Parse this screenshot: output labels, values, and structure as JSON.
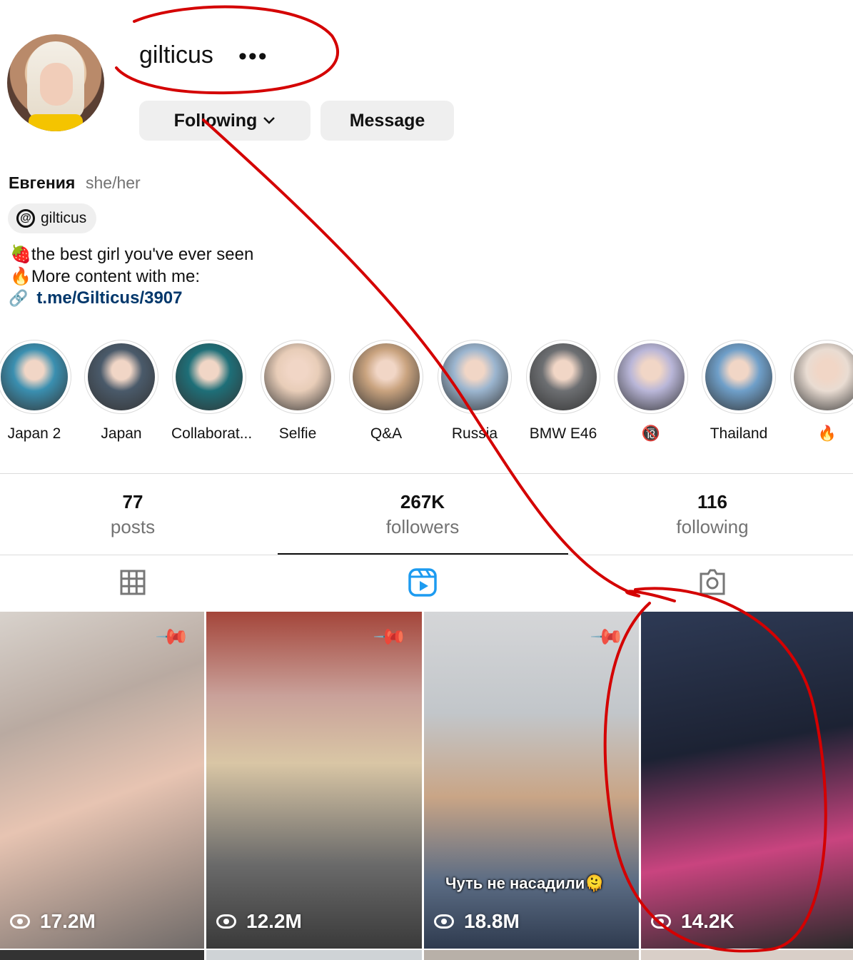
{
  "profile": {
    "username": "gilticus",
    "more_label": "•••",
    "following_label": "Following",
    "message_label": "Message",
    "name": "Евгения",
    "pronouns": "she/her",
    "threads_handle": "gilticus",
    "bio_line1": "🍓the best girl you've ever seen",
    "bio_line2": "🔥More content with me:",
    "link": "t.me/Gilticus/3907"
  },
  "highlights": [
    {
      "label": "Japan 2",
      "icon": "highlight-cover",
      "color": "#3a8fb0"
    },
    {
      "label": "Japan",
      "icon": "highlight-cover",
      "color": "#4a5a6a"
    },
    {
      "label": "Collaborat...",
      "icon": "highlight-cover",
      "color": "#1e6f78"
    },
    {
      "label": "Selfie",
      "icon": "highlight-cover",
      "color": "#e8cdb8"
    },
    {
      "label": "Q&A",
      "icon": "highlight-cover",
      "color": "#c9a37f"
    },
    {
      "label": "Russia",
      "icon": "highlight-cover",
      "color": "#9bb5cf"
    },
    {
      "label": "BMW E46",
      "icon": "highlight-cover",
      "color": "#6d6f72"
    },
    {
      "label": "🔞",
      "icon": "highlight-cover",
      "color": "#b9b6d8"
    },
    {
      "label": "Thailand",
      "icon": "highlight-cover",
      "color": "#6f9fc9"
    },
    {
      "label": "🔥",
      "icon": "highlight-cover",
      "color": "#e9dcd2"
    }
  ],
  "stats": {
    "posts_count": "77",
    "posts_label": "posts",
    "followers_count": "267K",
    "followers_label": "followers",
    "following_count": "116",
    "following_label": "following"
  },
  "tabs": [
    {
      "name": "grid",
      "icon": "grid-icon",
      "active": false
    },
    {
      "name": "reels",
      "icon": "reels-icon",
      "active": true
    },
    {
      "name": "tagged",
      "icon": "tagged-icon",
      "active": false
    }
  ],
  "reels": [
    {
      "views": "17.2M",
      "pinned": true,
      "caption": ""
    },
    {
      "views": "12.2M",
      "pinned": true,
      "caption": ""
    },
    {
      "views": "18.8M",
      "pinned": true,
      "caption": "Чуть не насадили🫠"
    },
    {
      "views": "14.2K",
      "pinned": false,
      "caption": ""
    }
  ],
  "colors": {
    "link": "#00376b",
    "reels_active": "#1d9bf0",
    "annotation": "#d40000",
    "button_bg": "#efefef"
  }
}
